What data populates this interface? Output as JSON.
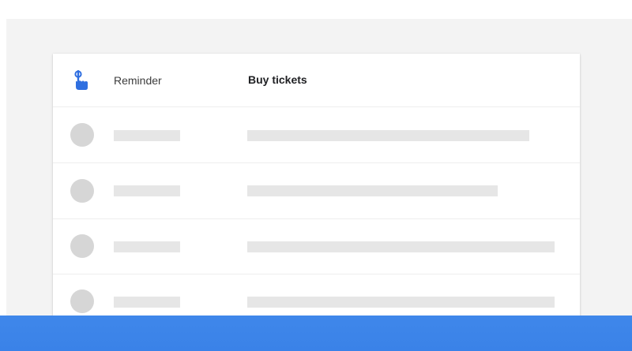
{
  "reminder_card": {
    "icon": "reminder-hand-icon",
    "label": "Reminder",
    "title": "Buy tickets"
  },
  "placeholder_rows": [
    {
      "type": "skeleton"
    },
    {
      "type": "skeleton"
    },
    {
      "type": "skeleton"
    },
    {
      "type": "skeleton"
    }
  ],
  "colors": {
    "accent": "#3b82e8",
    "icon_blue": "#2f6fe0",
    "skeleton_bar": "#e6e6e6",
    "skeleton_avatar": "#d6d6d6",
    "background": "#f3f3f3"
  }
}
